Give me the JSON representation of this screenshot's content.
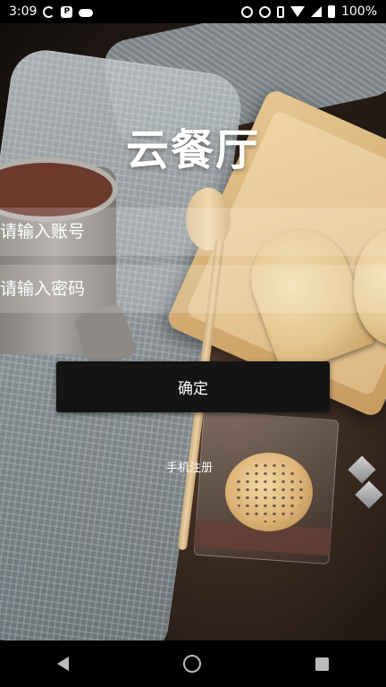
{
  "status_bar": {
    "time": "3:09",
    "battery": "100%",
    "icons_left": [
      "sync-icon",
      "p-badge-icon",
      "cloud-icon"
    ],
    "icons_right": [
      "alarm-icon",
      "data-saver-icon",
      "vibrate-icon",
      "wifi-icon",
      "signal-icon",
      "battery-icon"
    ]
  },
  "app": {
    "title": "云餐厅"
  },
  "login": {
    "account_placeholder": "请输入账号",
    "password_placeholder": "请输入密码",
    "confirm_label": "确定",
    "register_label": "手机注册"
  },
  "nav_bar": {
    "icons": [
      "back-icon",
      "home-icon",
      "recent-apps-icon"
    ]
  },
  "colors": {
    "button_bg": "#141414",
    "text": "#ffffff",
    "input_overlay": "rgba(255,255,255,0.18)"
  }
}
